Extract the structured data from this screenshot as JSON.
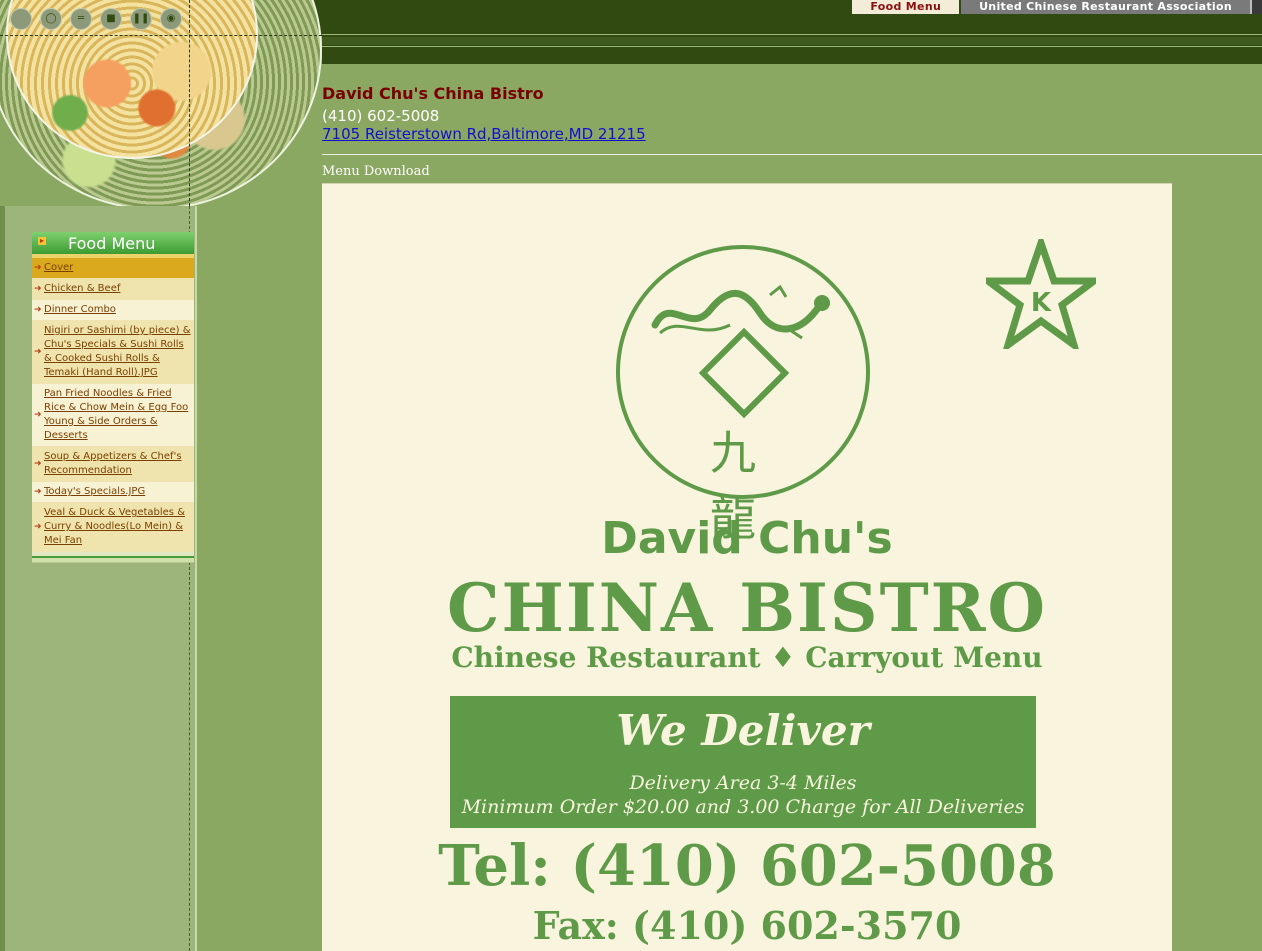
{
  "top_nav": {
    "food_menu": "Food Menu",
    "association": "United Chinese Restaurant Association"
  },
  "restaurant": {
    "name": "David Chu's China Bistro",
    "phone": "(410) 602-5008",
    "address": "7105 Reisterstown Rd,Baltimore,MD 21215"
  },
  "menu_download": "Menu Download",
  "sidebar": {
    "title": "Food Menu",
    "items": [
      {
        "label": "Cover",
        "active": true
      },
      {
        "label": "Chicken & Beef"
      },
      {
        "label": "Dinner Combo"
      },
      {
        "label": "Nigiri or Sashimi (by piece) & Chu's Specials & Sushi Rolls & Cooked Sushi Rolls & Temaki (Hand Roll).JPG"
      },
      {
        "label": "Pan Fried Noodles & Fried Rice & Chow Mein & Egg Foo Young & Side Orders & Desserts"
      },
      {
        "label": "Soup & Appetizers & Chef's Recommendation"
      },
      {
        "label": "Today's Specials.JPG"
      },
      {
        "label": "Veal & Duck & Vegetables & Curry & Noodles(Lo Mein) & Mei Fan"
      }
    ]
  },
  "menu_image": {
    "chinese_chars": "九 龍",
    "star_letter": "K",
    "name_line": "David Chu's",
    "brand": "CHINA BISTRO",
    "subtitle": "Chinese Restaurant ♦ Carryout Menu",
    "deliver": "We Deliver",
    "delivery_area": "Delivery Area 3-4 Miles",
    "minimum_order": "Minimum Order $20.00 and 3.00 Charge for All Deliveries",
    "tel": "Tel: (410) 602-5008",
    "fax": "Fax: (410) 602-3570"
  },
  "colors": {
    "background": "#8ba862",
    "header_dark": "#314a12",
    "menu_green": "#5e9a48",
    "name_red": "#7a0000",
    "link_blue": "#1010d0"
  }
}
